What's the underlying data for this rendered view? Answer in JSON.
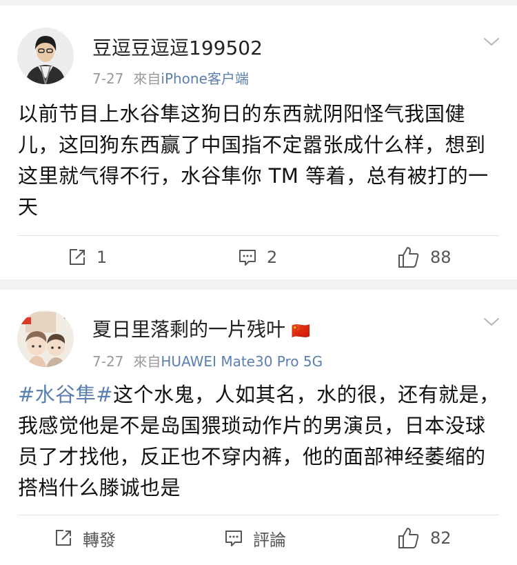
{
  "posts": [
    {
      "username": "豆逗豆逗逗199502",
      "date": "7-27",
      "source_prefix": "來自",
      "source": "iPhone客户端",
      "content": "以前节目上水谷隼这狗日的东西就阴阳怪气我国健儿，这回狗东西赢了中国指不定嚣张成什么样，想到这里就气得不行，水谷隼你 TM 等着，总有被打的一天",
      "repost_label": "1",
      "comment_label": "2",
      "like_label": "88"
    },
    {
      "username": "夏日里落剩的一片残叶",
      "username_badge": "🇨🇳",
      "date": "7-27",
      "source_prefix": "來自",
      "source": "HUAWEI Mate30 Pro 5G",
      "topic": "#水谷隼#",
      "content": "这个水鬼，人如其名，水的很，还有就是，我感觉他是不是岛国猥琐动作片的男演员，日本没球员了才找他，反正也不穿内裤，他的面部神经萎缩的搭档什么滕诚也是",
      "repost_label": "轉發",
      "comment_label": "評論",
      "like_label": "82"
    }
  ],
  "icons": [
    "repost-icon",
    "comment-icon",
    "like-icon",
    "chevron-down-icon"
  ],
  "colors": {
    "link": "#5b7fb0",
    "meta": "#9a9a9a",
    "text": "#111111",
    "background": "#f2f2f2"
  }
}
